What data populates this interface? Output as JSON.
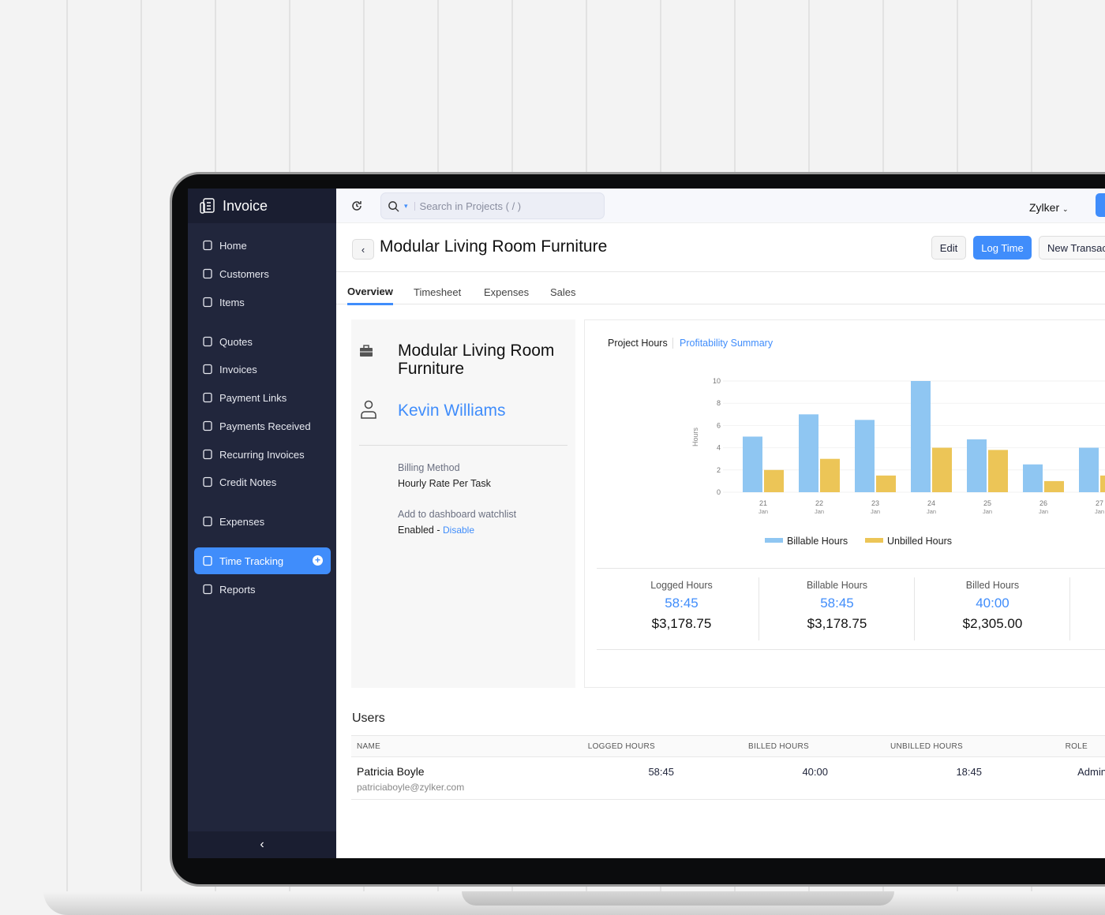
{
  "sidebar": {
    "brand": "Invoice",
    "items": [
      {
        "label": "Home",
        "icon": "home-icon"
      },
      {
        "label": "Customers",
        "icon": "user-icon"
      },
      {
        "label": "Items",
        "icon": "basket-icon"
      },
      {
        "label": "Quotes",
        "icon": "calculator-icon"
      },
      {
        "label": "Invoices",
        "icon": "document-icon"
      },
      {
        "label": "Payment Links",
        "icon": "link-icon"
      },
      {
        "label": "Payments Received",
        "icon": "download-icon"
      },
      {
        "label": "Recurring Invoices",
        "icon": "refresh-icon"
      },
      {
        "label": "Credit Notes",
        "icon": "credit-note-icon"
      },
      {
        "label": "Expenses",
        "icon": "receipt-icon"
      },
      {
        "label": "Time Tracking",
        "icon": "stopwatch-icon",
        "active": true
      },
      {
        "label": "Reports",
        "icon": "bar-chart-icon"
      }
    ]
  },
  "topbar": {
    "search_placeholder": "Search in Projects ( / )",
    "org": "Zylker"
  },
  "header": {
    "title": "Modular Living Room Furniture",
    "edit": "Edit",
    "log_time": "Log Time",
    "new_transaction": "New Transac"
  },
  "tabs": [
    "Overview",
    "Timesheet",
    "Expenses",
    "Sales"
  ],
  "project": {
    "name": "Modular Living Room Furniture",
    "customer": "Kevin Williams",
    "billing_label": "Billing Method",
    "billing_value": "Hourly Rate Per Task",
    "watch_label": "Add to dashboard watchlist",
    "watch_value": "Enabled - ",
    "watch_link": "Disable"
  },
  "chart_tabs": {
    "active": "Project Hours",
    "other": "Profitability Summary"
  },
  "chart_data": {
    "type": "bar",
    "ylabel": "Hours",
    "ylim": [
      0,
      10
    ],
    "yticks": [
      0,
      2,
      4,
      6,
      8,
      10
    ],
    "categories": [
      [
        "21",
        "Jan"
      ],
      [
        "22",
        "Jan"
      ],
      [
        "23",
        "Jan"
      ],
      [
        "24",
        "Jan"
      ],
      [
        "25",
        "Jan"
      ],
      [
        "26",
        "Jan"
      ],
      [
        "27",
        "Jan"
      ]
    ],
    "series": [
      {
        "name": "Billable Hours",
        "color": "#8fc6f2",
        "values": [
          5,
          7,
          6.5,
          10,
          4.75,
          2.5,
          4
        ]
      },
      {
        "name": "Unbilled Hours",
        "color": "#ecc557",
        "values": [
          2,
          3,
          1.5,
          4,
          3.8,
          1,
          1.5
        ]
      }
    ],
    "legend": "bottom",
    "grid": true
  },
  "stats": [
    {
      "label": "Logged Hours",
      "hours": "58:45",
      "amount": "$3,178.75"
    },
    {
      "label": "Billable Hours",
      "hours": "58:45",
      "amount": "$3,178.75"
    },
    {
      "label": "Billed Hours",
      "hours": "40:00",
      "amount": "$2,305.00"
    }
  ],
  "users": {
    "title": "Users",
    "columns": [
      "NAME",
      "LOGGED HOURS",
      "BILLED HOURS",
      "UNBILLED HOURS",
      "ROLE"
    ],
    "rows": [
      {
        "name": "Patricia Boyle",
        "email": "patriciaboyle@zylker.com",
        "logged": "58:45",
        "billed": "40:00",
        "unbilled": "18:45",
        "role": "Admin"
      }
    ]
  },
  "colors": {
    "accent": "#408dfb",
    "sidebar": "#21263c"
  }
}
